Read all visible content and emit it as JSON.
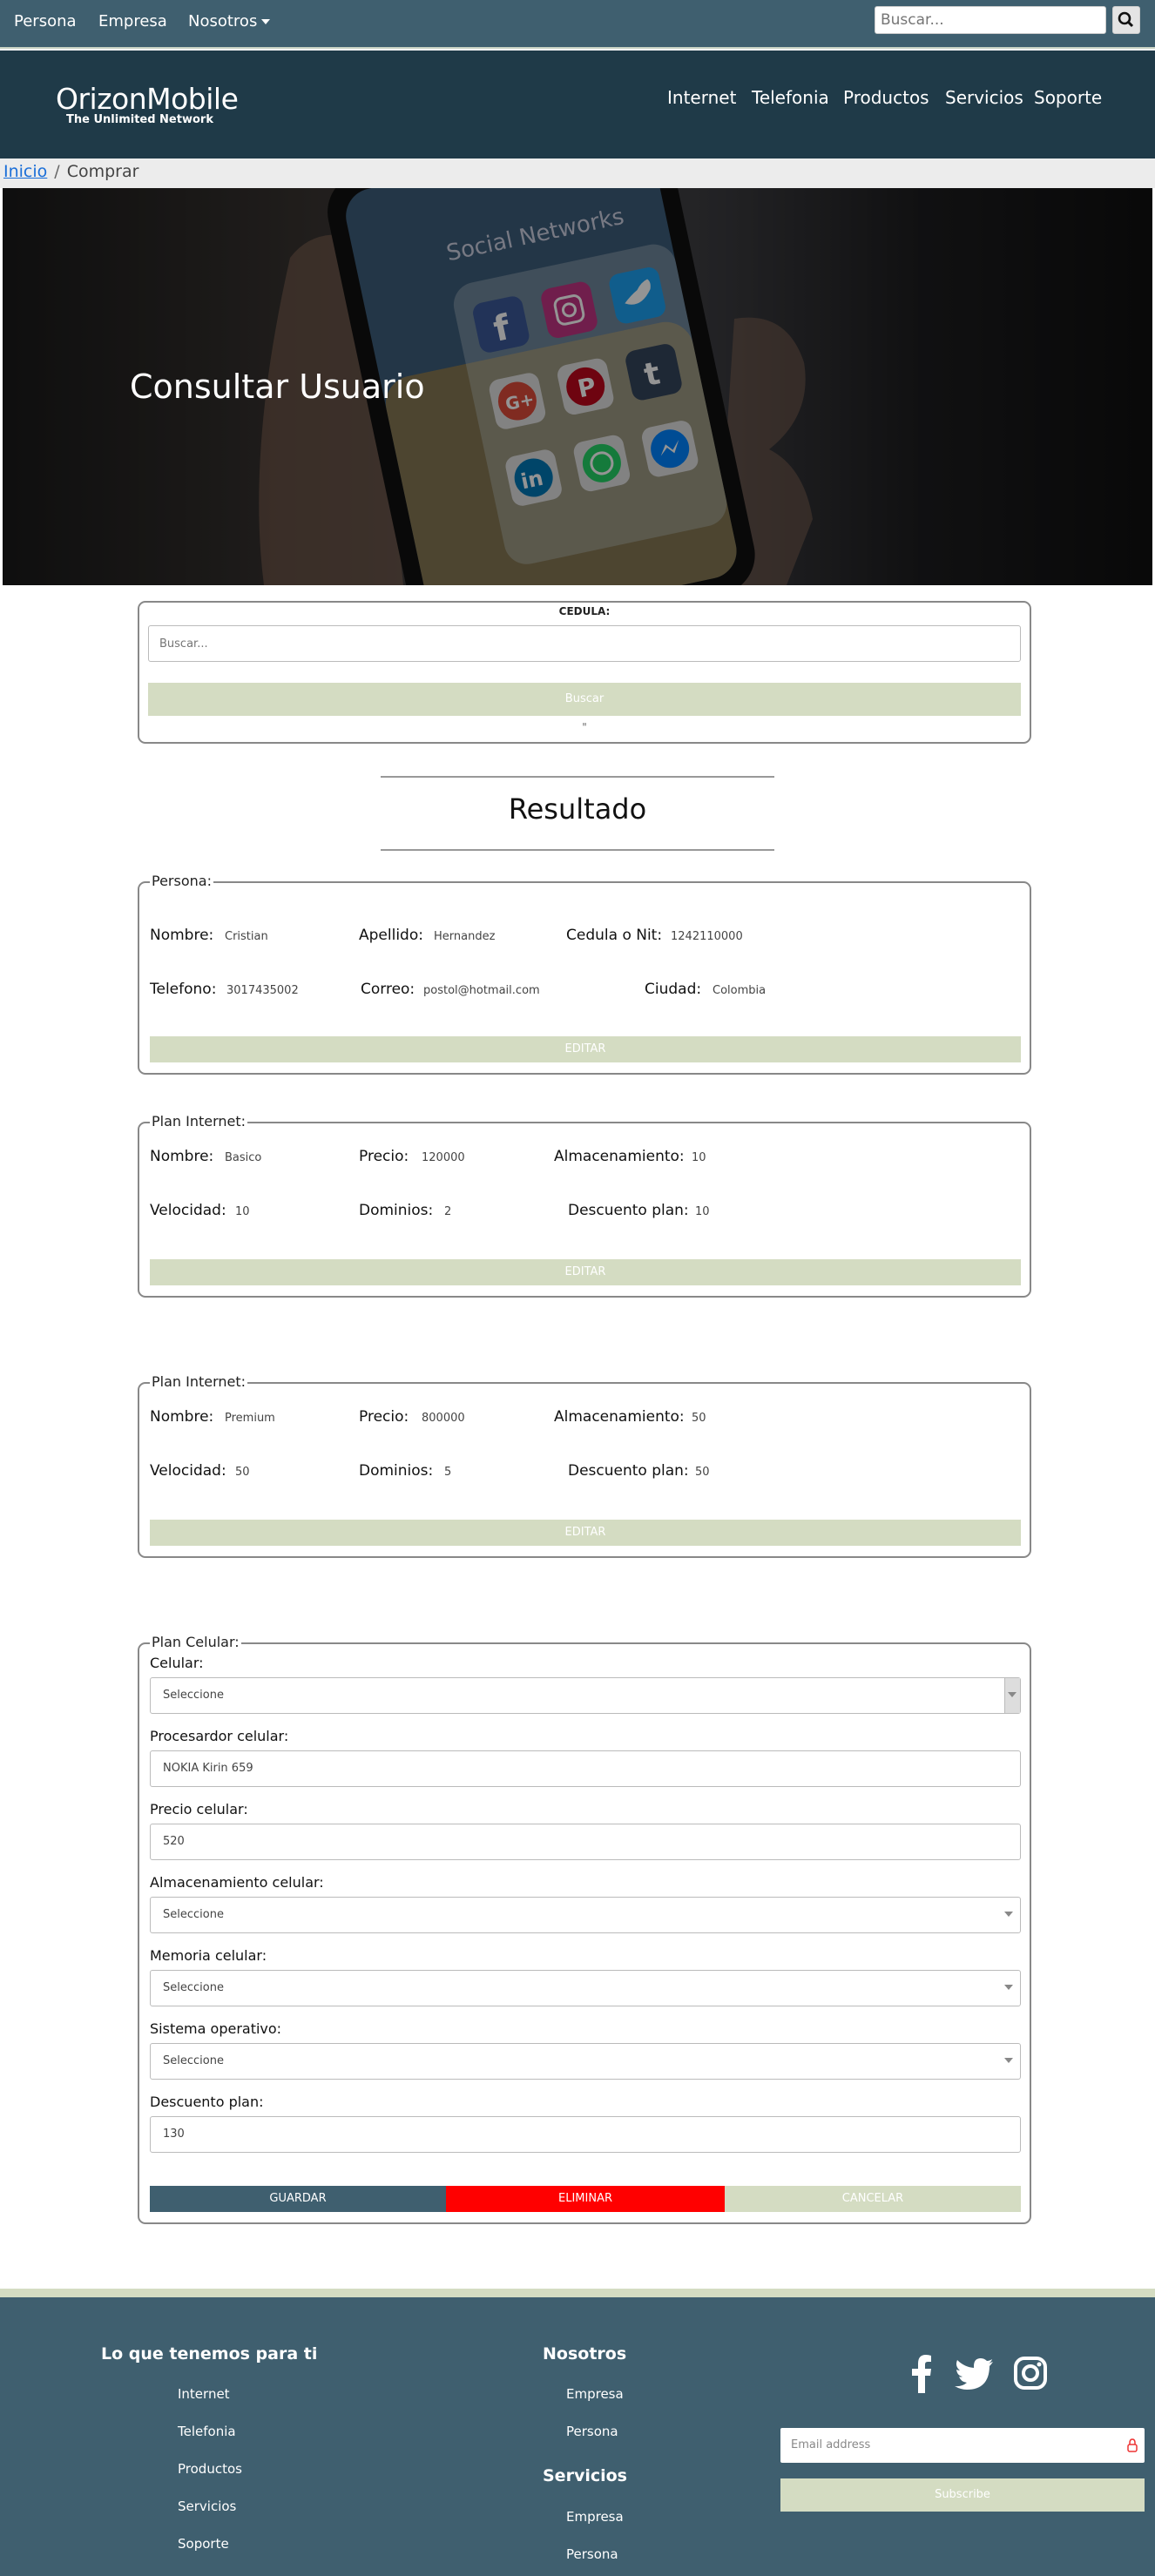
{
  "topbar": {
    "persona": "Persona",
    "empresa": "Empresa",
    "nosotros": "Nosotros",
    "search_placeholder": "Buscar..."
  },
  "header": {
    "logo": "OrizonMobile",
    "tagline": "The Unlimited Network",
    "nav": [
      "Internet",
      "Telefonia",
      "Productos",
      "Servicios",
      "Soporte"
    ]
  },
  "breadcrumb": {
    "home": "Inicio",
    "sep": "/",
    "current": "Comprar"
  },
  "hero": {
    "title": "Consultar Usuario",
    "image_text": "Social Networks",
    "apps": [
      "Facebook",
      "Instagram",
      "Twitter",
      "Google+",
      "Pinterest",
      "Tumblr",
      "LinkedIn",
      "WhatsApp",
      "Messenger"
    ]
  },
  "search_card": {
    "label": "CEDULA:",
    "placeholder": "Buscar...",
    "button": "Buscar",
    "note": "\""
  },
  "result_title": "Resultado",
  "persona": {
    "legend": "Persona:",
    "nombre_label": "Nombre:",
    "nombre": "Cristian",
    "apellido_label": "Apellido:",
    "apellido": "Hernandez",
    "cedula_label": "Cedula o Nit:",
    "cedula": "1242110000",
    "telefono_label": "Telefono:",
    "telefono": "3017435002",
    "correo_label": "Correo:",
    "correo": "postol@hotmail.com",
    "ciudad_label": "Ciudad:",
    "ciudad": "Colombia",
    "button": "EDITAR"
  },
  "plan1": {
    "legend": "Plan Internet:",
    "nombre_label": "Nombre:",
    "nombre": "Basico",
    "precio_label": "Precio:",
    "precio": "120000",
    "alm_label": "Almacenamiento:",
    "alm": "10",
    "vel_label": "Velocidad:",
    "vel": "10",
    "dom_label": "Dominios:",
    "dom": "2",
    "desc_label": "Descuento plan:",
    "desc": "10",
    "button": "EDITAR"
  },
  "plan2": {
    "legend": "Plan Internet:",
    "nombre_label": "Nombre:",
    "nombre": "Premium",
    "precio_label": "Precio:",
    "precio": "800000",
    "alm_label": "Almacenamiento:",
    "alm": "50",
    "vel_label": "Velocidad:",
    "vel": "50",
    "dom_label": "Dominios:",
    "dom": "5",
    "desc_label": "Descuento plan:",
    "desc": "50",
    "button": "EDITAR"
  },
  "celular": {
    "legend": "Plan Celular:",
    "celular_label": "Celular:",
    "celular": "Seleccione",
    "proc_label": "Procesardor celular:",
    "proc": "NOKIA Kirin 659",
    "precio_label": "Precio celular:",
    "precio": "520",
    "alm_label": "Almacenamiento celular:",
    "alm": "Seleccione",
    "mem_label": "Memoria celular:",
    "mem": "Seleccione",
    "so_label": "Sistema operativo:",
    "so": "Seleccione",
    "desc_label": "Descuento plan:",
    "desc": "130",
    "guardar": "GUARDAR",
    "eliminar": "ELIMINAR",
    "cancelar": "CANCELAR"
  },
  "footer": {
    "col1_title": "Lo que tenemos para ti",
    "col1_links": [
      "Internet",
      "Telefonia",
      "Productos",
      "Servicios",
      "Soporte"
    ],
    "col2_title": "Nosotros",
    "col2_links": [
      "Empresa",
      "Persona"
    ],
    "col3_title": "Servicios",
    "col3_links": [
      "Empresa",
      "Persona"
    ],
    "email_placeholder": "Email address",
    "subscribe": "Subscribe"
  },
  "colors": {
    "topbar": "#3f5f6f",
    "header": "#1f3a48",
    "accent_green": "#d4dcc2",
    "guardar": "#3f5f6f",
    "eliminar": "#ff0000"
  }
}
